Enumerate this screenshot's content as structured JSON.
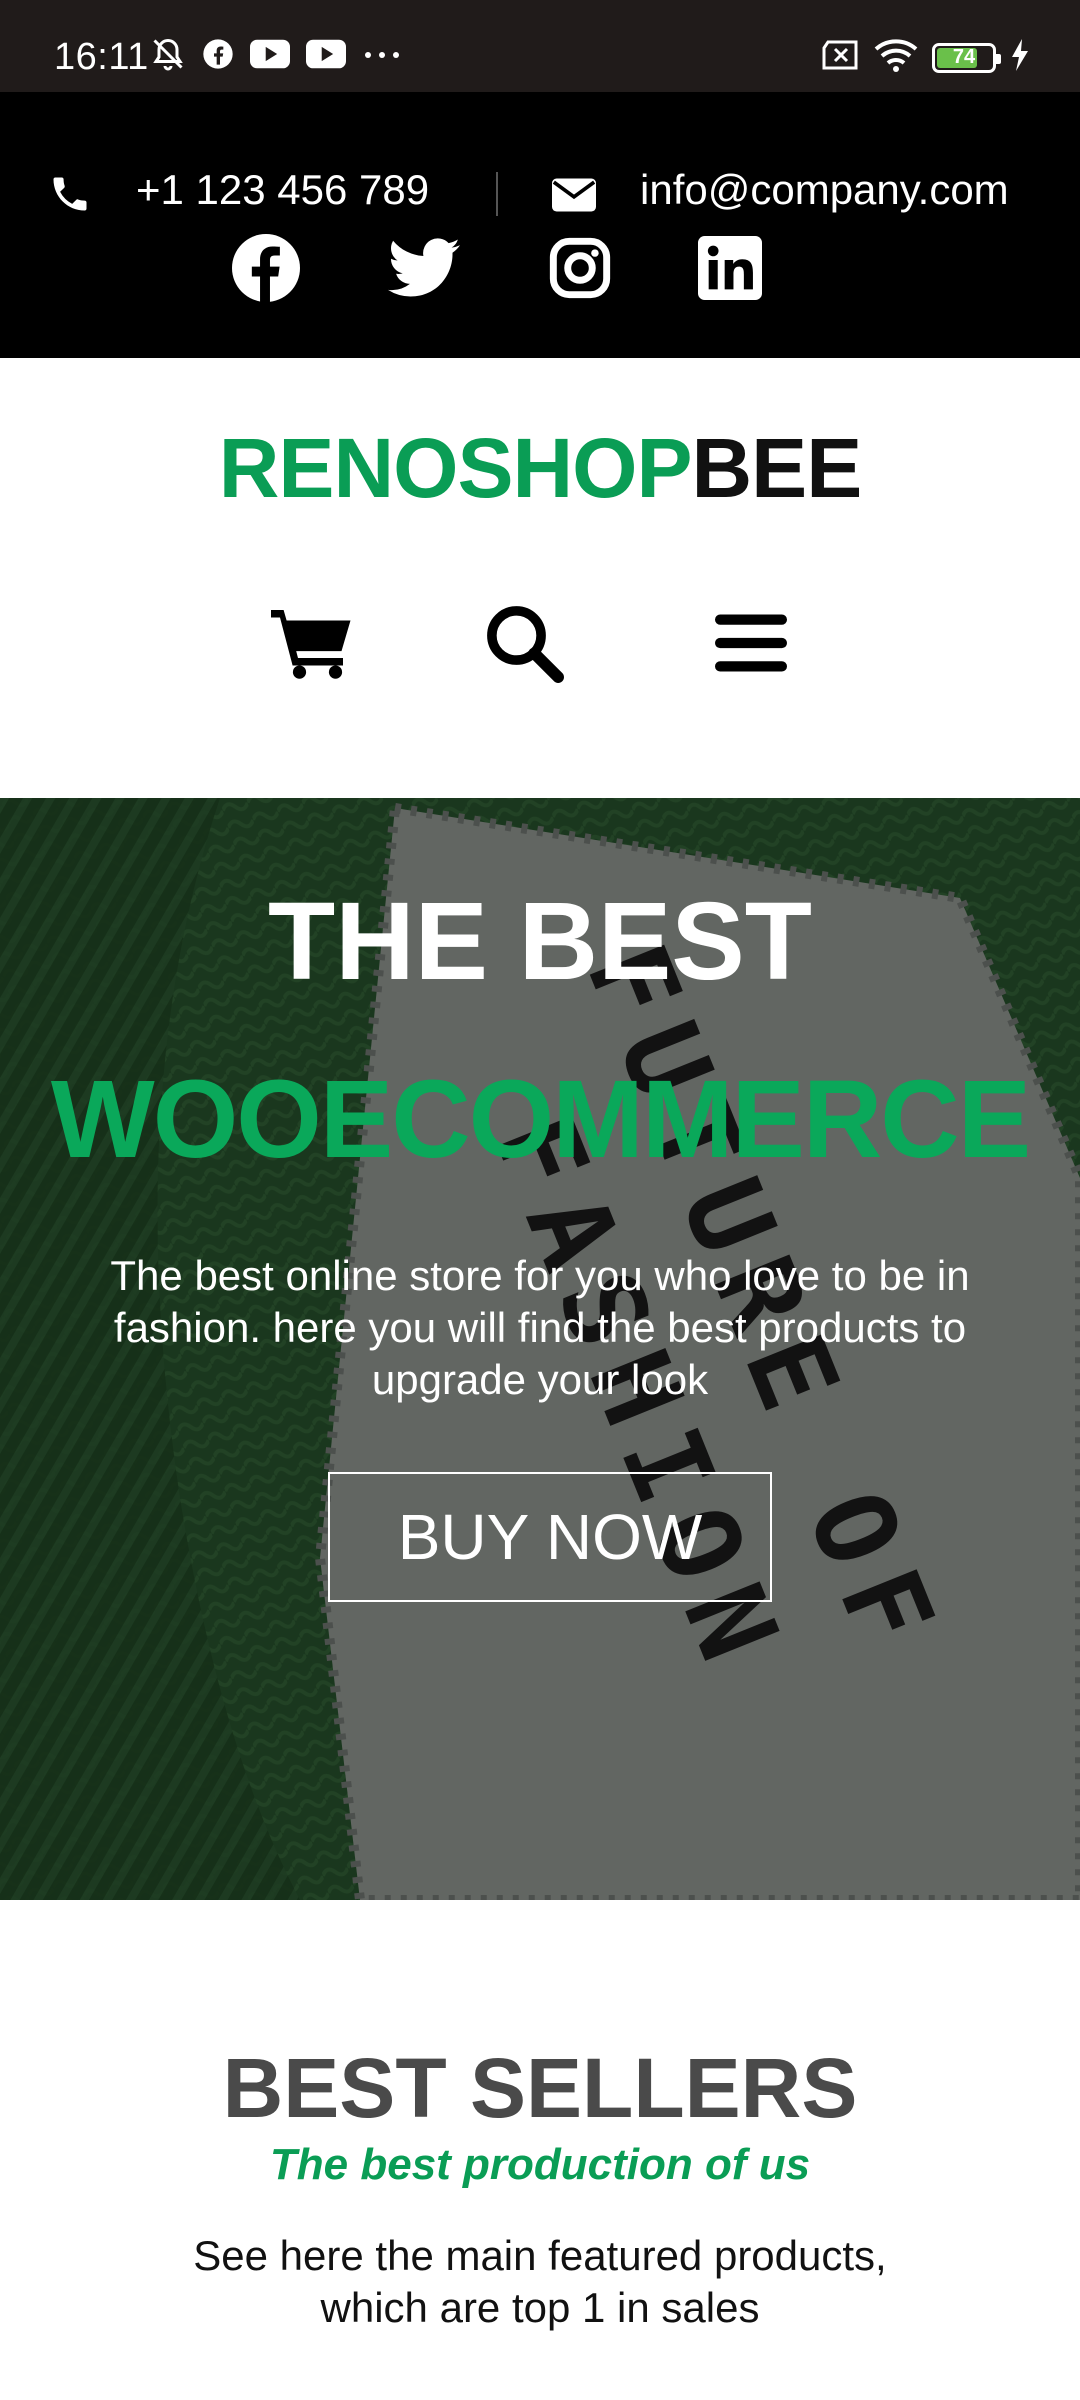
{
  "status_bar": {
    "time": "16:11",
    "battery_level": "74",
    "battery_fraction": 0.74,
    "icons": [
      "bell-muted-icon",
      "facebook-icon",
      "youtube-icon",
      "youtube-icon",
      "more-icon",
      "sim-icon",
      "wifi-icon",
      "battery-icon",
      "charging-icon"
    ]
  },
  "contact": {
    "phone": "+1 123 456 789",
    "email": "info@company.com",
    "social": [
      "facebook",
      "twitter",
      "instagram",
      "linkedin"
    ]
  },
  "header": {
    "logo_green": "RENOSHOP",
    "logo_black": "BEE",
    "nav": [
      "cart-icon",
      "search-icon",
      "menu-icon"
    ]
  },
  "hero": {
    "title_line1": "THE BEST",
    "title_line2": "WOOECOMMERCE",
    "description": "The best online store for you who love to be in fashion. here you will find the best products to upgrade your look",
    "button_label": "BUY NOW",
    "label_line1": "FUTURE OF",
    "label_line2": "FASHION"
  },
  "best_sellers": {
    "title": "BEST SELLERS",
    "subtitle": "The best production of us",
    "description": "See here the main featured products, which are top 1 in sales"
  },
  "colors": {
    "brand_green": "#0a9d55",
    "topbar_bg": "#000000",
    "statusbar_bg": "#201b1a",
    "hero_green": "#0aa85a"
  }
}
